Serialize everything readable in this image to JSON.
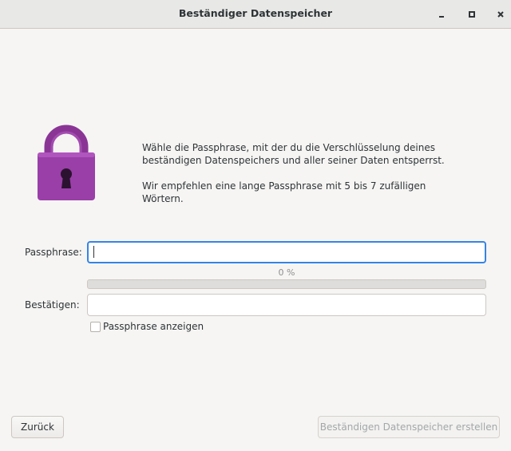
{
  "window": {
    "title": "Beständiger Datenspeicher",
    "controls": [
      "minimize-icon",
      "maximize-icon",
      "close-icon"
    ]
  },
  "description": {
    "line1": "Wähle die Passphrase, mit der du die Verschlüsselung deines",
    "line2": "beständigen Datenspeichers und aller seiner Daten entsperrst.",
    "recommendation": "Wir empfehlen eine lange Passphrase mit 5 bis 7 zufälligen Wörtern."
  },
  "form": {
    "passphrase_label": "Passphrase:",
    "passphrase_value": "",
    "strength_text": "0 %",
    "strength_fraction": 0,
    "confirm_label": "Bestätigen:",
    "confirm_value": "",
    "show_label": "Passphrase anzeigen",
    "show_checked": false
  },
  "buttons": {
    "back": "Zurück",
    "create": "Beständigen Datenspeicher erstellen"
  },
  "colors": {
    "lock_body": "#9a3fa8",
    "lock_shackle": "#8a3596",
    "focus": "#3584e4"
  }
}
